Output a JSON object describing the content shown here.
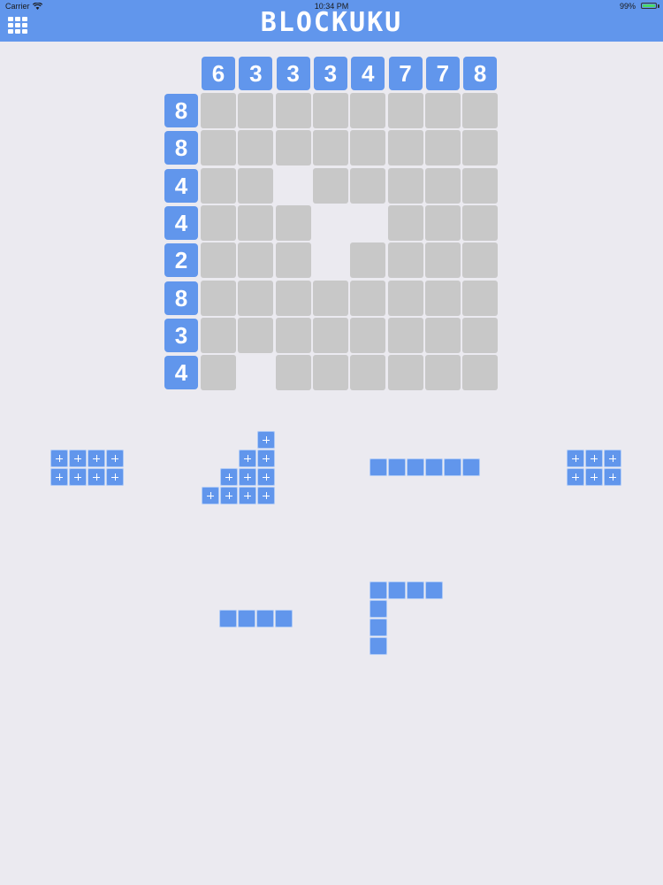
{
  "status_bar": {
    "carrier": "Carrier",
    "time": "10:34 PM",
    "battery": "99%"
  },
  "header": {
    "menu_icon": "grid-menu-icon",
    "title": "BLOCKUKU"
  },
  "board": {
    "column_clues": [
      "6",
      "3",
      "3",
      "3",
      "4",
      "7",
      "7",
      "8"
    ],
    "row_clues": [
      "8",
      "8",
      "4",
      "4",
      "2",
      "8",
      "3",
      "4"
    ],
    "grid": [
      [
        1,
        1,
        1,
        1,
        1,
        1,
        1,
        1
      ],
      [
        1,
        1,
        1,
        1,
        1,
        1,
        1,
        1
      ],
      [
        1,
        1,
        0,
        1,
        1,
        1,
        1,
        1
      ],
      [
        1,
        1,
        1,
        0,
        0,
        1,
        1,
        1
      ],
      [
        1,
        1,
        1,
        0,
        1,
        1,
        1,
        1
      ],
      [
        1,
        1,
        1,
        1,
        1,
        1,
        1,
        1
      ],
      [
        1,
        1,
        1,
        1,
        1,
        1,
        1,
        1
      ],
      [
        1,
        0,
        1,
        1,
        1,
        1,
        1,
        1
      ]
    ]
  },
  "colors": {
    "accent": "#6196ec",
    "cell": "#c8c8c8",
    "background": "#ebeaf0"
  },
  "pieces": [
    {
      "name": "piece-2x4-block",
      "cells": [
        [
          0,
          0
        ],
        [
          0,
          1
        ],
        [
          0,
          2
        ],
        [
          0,
          3
        ],
        [
          1,
          0
        ],
        [
          1,
          1
        ],
        [
          1,
          2
        ],
        [
          1,
          3
        ]
      ]
    },
    {
      "name": "piece-staircase",
      "cells": [
        [
          0,
          3
        ],
        [
          1,
          2
        ],
        [
          1,
          3
        ],
        [
          2,
          1
        ],
        [
          2,
          2
        ],
        [
          2,
          3
        ],
        [
          3,
          0
        ],
        [
          3,
          1
        ],
        [
          3,
          2
        ],
        [
          3,
          3
        ]
      ]
    },
    {
      "name": "piece-6-bar",
      "cells": [
        [
          0,
          0
        ],
        [
          0,
          1
        ],
        [
          0,
          2
        ],
        [
          0,
          3
        ],
        [
          0,
          4
        ],
        [
          0,
          5
        ]
      ]
    },
    {
      "name": "piece-2x3-block",
      "cells": [
        [
          0,
          0
        ],
        [
          0,
          1
        ],
        [
          0,
          2
        ],
        [
          1,
          0
        ],
        [
          1,
          1
        ],
        [
          1,
          2
        ]
      ]
    },
    {
      "name": "piece-4-bar",
      "cells": [
        [
          0,
          0
        ],
        [
          0,
          1
        ],
        [
          0,
          2
        ],
        [
          0,
          3
        ]
      ]
    },
    {
      "name": "piece-l-shape",
      "cells": [
        [
          0,
          0
        ],
        [
          0,
          1
        ],
        [
          0,
          2
        ],
        [
          0,
          3
        ],
        [
          1,
          0
        ],
        [
          2,
          0
        ],
        [
          3,
          0
        ]
      ]
    }
  ]
}
